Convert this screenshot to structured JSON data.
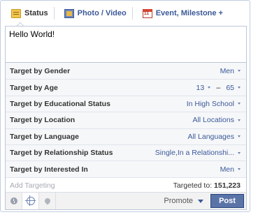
{
  "tabs": [
    {
      "label": "Status",
      "icon": "status-icon"
    },
    {
      "label": "Photo / Video",
      "icon": "photo-icon"
    },
    {
      "label": "Event, Milestone +",
      "icon": "calendar-icon"
    }
  ],
  "composer": {
    "text": "Hello World!"
  },
  "targeting": {
    "gender": {
      "label": "Target by Gender",
      "value": "Men"
    },
    "age": {
      "label": "Target by Age",
      "min": "13",
      "sep": "–",
      "max": "65"
    },
    "education": {
      "label": "Target by Educational Status",
      "value": "In High School"
    },
    "location": {
      "label": "Target by Location",
      "value": "All Locations"
    },
    "language": {
      "label": "Target by Language",
      "value": "All Languages"
    },
    "relationship": {
      "label": "Target by Relationship Status",
      "value": "Single,In a Relationshi..."
    },
    "interested": {
      "label": "Target by Interested In",
      "value": "Men"
    }
  },
  "add_targeting": {
    "placeholder": "Add Targeting",
    "targeted_label": "Targeted to:",
    "targeted_count": "151,223"
  },
  "footer": {
    "promote_label": "Promote",
    "post_label": "Post"
  },
  "colors": {
    "link": "#3b5998",
    "post_button": "#5b74a8",
    "border": "#bdc7d8"
  }
}
